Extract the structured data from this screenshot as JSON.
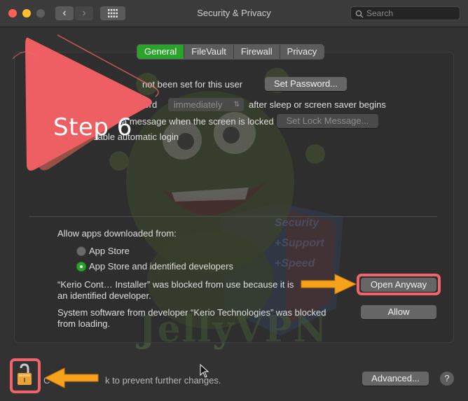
{
  "window": {
    "title": "Security & Privacy",
    "search_placeholder": "Search"
  },
  "tabs": [
    {
      "label": "General",
      "active": true
    },
    {
      "label": "FileVault",
      "active": false
    },
    {
      "label": "Firewall",
      "active": false
    },
    {
      "label": "Privacy",
      "active": false
    }
  ],
  "general": {
    "password_text": "not been set for this user",
    "set_password_label": "Set Password...",
    "require_text_a": "ssword",
    "require_select_value": "immediately",
    "require_text_b": "after sleep or screen saver begins",
    "lock_message_text": "a message when the screen is locked",
    "set_lock_message_label": "Set Lock Message...",
    "auto_login_text": "sable automatic login"
  },
  "apps": {
    "heading": "Allow apps downloaded from:",
    "options": [
      {
        "label": "App Store",
        "selected": false
      },
      {
        "label": "App Store and identified developers",
        "selected": true
      }
    ],
    "blocked_message_line1": "“Kerio Cont… Installer” was blocked from use because it is",
    "blocked_message_line2": "an identified developer.",
    "open_anyway_label": "Open Anyway",
    "system_message_line1": "System software from developer “Kerio Technologies” was blocked",
    "system_message_line2": "from loading.",
    "allow_label": "Allow"
  },
  "footer": {
    "lock_text": "k to prevent further changes.",
    "lock_prefix": "C",
    "advanced_label": "Advanced...",
    "help_label": "?"
  },
  "overlay": {
    "step_label": "Step 6",
    "watermark_lines": [
      "Security",
      "+Support",
      "+Speed"
    ],
    "watermark_brand": "JellyVPN"
  },
  "colors": {
    "accent_green": "#29a329",
    "highlight_red": "#f0646c",
    "arrow_orange": "#f7a21b"
  }
}
